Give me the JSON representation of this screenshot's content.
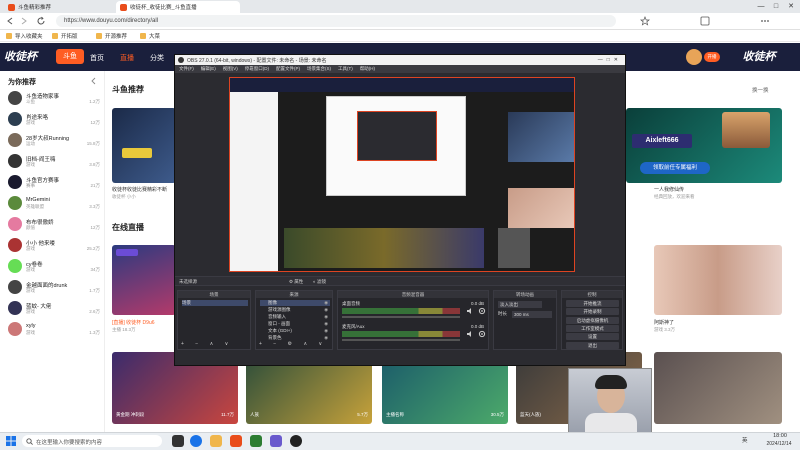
{
  "browser": {
    "tabs": [
      {
        "label": "斗鱼精彩推荐",
        "active": false
      },
      {
        "label": "收徒杯_收徒比赛_斗鱼直播",
        "active": true
      }
    ],
    "url": "https://www.douyu.com/directory/all",
    "bookmarks": [
      "导入收藏夹",
      "开拓版",
      "开源推荐",
      "大菜"
    ],
    "window_controls": [
      "—",
      "□",
      "✕"
    ]
  },
  "site": {
    "logo": "斗鱼",
    "banner_left": "收徒杯",
    "banner_right": "收徒杯",
    "nav": [
      {
        "label": "首页",
        "active": false
      },
      {
        "label": "直播",
        "active": true
      },
      {
        "label": "分类",
        "active": false
      }
    ],
    "user_badge": "开播"
  },
  "sidebar": {
    "title": "为你推荐",
    "items": [
      {
        "name": "斗鱼造物家事",
        "sub": "斗鱼",
        "count": "1.2万",
        "color": "#444"
      },
      {
        "name": "肖途来咯",
        "sub": "游戏",
        "count": "12万",
        "color": "#2c3e50"
      },
      {
        "name": "28岁大叔Running",
        "sub": "运动",
        "count": "15.8万",
        "color": "#7a6a5a"
      },
      {
        "name": "旧档-阎王嗨",
        "sub": "游戏",
        "count": "3.8万",
        "color": "#333"
      },
      {
        "name": "斗鱼官方赛事",
        "sub": "赛事",
        "count": "21万",
        "color": "#1a1a2e"
      },
      {
        "name": "MrGemini",
        "sub": "英雄联盟",
        "count": "3.3万",
        "color": "#5b8a3c"
      },
      {
        "name": "布布很傲娇",
        "sub": "颜值",
        "count": "12万",
        "color": "#e57aa0"
      },
      {
        "name": "小小 他来喽",
        "sub": "游戏",
        "count": "25.2万",
        "color": "#a33"
      },
      {
        "name": "cy卷卷",
        "sub": "游戏",
        "count": "34万",
        "color": "#6d5"
      },
      {
        "name": "金越面面的drunk",
        "sub": "游戏",
        "count": "1.7万",
        "color": "#444"
      },
      {
        "name": "蓝蚊- 大佬",
        "sub": "游戏",
        "count": "2.6万",
        "color": "#335"
      },
      {
        "name": "xyly",
        "sub": "游戏",
        "count": "1.3万",
        "color": "#c77"
      }
    ]
  },
  "main": {
    "recommend_title": "斗鱼推荐",
    "online_title": "在线直播",
    "more_label": "换一换",
    "cards_top": [
      {
        "caption": "收徒杯收徒比赛精彩不断",
        "sub": "收徒杯 小小"
      },
      {
        "caption": "一人我修仙传",
        "sub": "经典回放，欢迎来看"
      }
    ],
    "promo_name": "Aixleft666",
    "promo_sub": "领取前任专属福利",
    "live_card": {
      "caption": "[直播] 收徒杯 D9u6",
      "sub": "主播 18.3万"
    },
    "cards_right": [
      {
        "caption": "阿斯神了",
        "sub": "游戏 3.3万"
      }
    ],
    "bottom_cards": [
      {
        "user": "黄金期 冲刺段",
        "count": "11.7万"
      },
      {
        "user": "人族",
        "count": "5.7万"
      },
      {
        "user": "主播名称",
        "count": "30.5万"
      },
      {
        "user": "蓝天(人族)",
        "count": "25.6万"
      }
    ]
  },
  "obs": {
    "title": "OBS 27.0.1 (64-bit, windows) - 配置文件: 未命名 - 场景: 未命名",
    "menu": [
      "文件(F)",
      "编辑(E)",
      "视图(V)",
      "停靠窗口(D)",
      "配置文件(P)",
      "场景集合(S)",
      "工具(T)",
      "帮助(H)"
    ],
    "status": "未选择源",
    "props_label": "属性",
    "filters_label": "滤镜",
    "docks": {
      "scenes": "场景",
      "sources": "来源",
      "mixer": "音频混音器",
      "transitions": "转场动画",
      "controls": "控制"
    },
    "scene_items": [
      "场景"
    ],
    "source_items": [
      "图像",
      "游戏源图像",
      "音频输入",
      "窗口 - 画面",
      "文本 (GDI+)",
      "背景色"
    ],
    "mixer_tracks": [
      {
        "label": "桌面音频",
        "db": "0.0 dB"
      },
      {
        "label": "麦克风/Aux",
        "db": "0.0 dB"
      }
    ],
    "transition": "淡入淡出",
    "duration_label": "时长",
    "duration": "300 ms",
    "controls": [
      "开始推流",
      "开始录制",
      "启动虚拟摄像机",
      "工作室模式",
      "设置",
      "退出"
    ]
  },
  "taskbar": {
    "search_placeholder": "在这里输入你要搜索的内容",
    "time": "18:00",
    "date": "2024/12/14",
    "ime": "英"
  }
}
